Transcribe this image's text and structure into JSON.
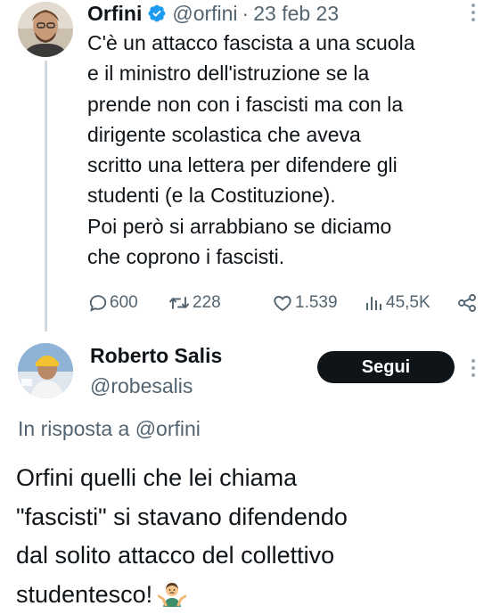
{
  "tweet": {
    "author_name": "Orfini",
    "author_handle": "@orfini",
    "separator": "·",
    "date": "23 feb 23",
    "text_lines": [
      "C'è un attacco fascista a una scuola",
      "e il ministro dell'istruzione se la",
      "prende non con i fascisti ma con la",
      "dirigente scolastica che aveva",
      "scritto una lettera per difendere gli",
      "studenti (e la Costituzione).",
      "Poi però si arrabbiano se diciamo",
      "che coprono i fascisti."
    ],
    "replies": "600",
    "retweets": "228",
    "likes": "1.539",
    "views": "45,5K"
  },
  "reply": {
    "author_name": "Roberto Salis",
    "author_handle": "@robesalis",
    "follow_label": "Segui",
    "in_reply_prefix": "In risposta a",
    "in_reply_handle": "@orfini",
    "text_lines": [
      "Orfini quelli che lei chiama",
      "\"fascisti\" si stavano difendendo",
      "dal solito attacco del collettivo",
      "studentesco!"
    ]
  },
  "colors": {
    "text": "#0f1419",
    "secondary": "#536471",
    "verified": "#1d9bf0",
    "thread_line": "#cfd9de",
    "button_bg": "#0f1419"
  },
  "icons": [
    "verified-badge-icon",
    "more-options-icon",
    "reply-icon",
    "retweet-icon",
    "like-icon",
    "views-icon",
    "share-icon",
    "person-shrugging-emoji"
  ]
}
